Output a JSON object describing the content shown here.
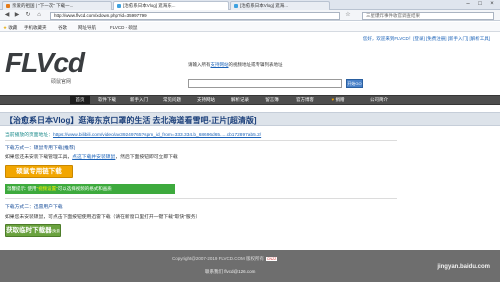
{
  "browser": {
    "tabs": [
      {
        "label": "亲爱的祖国 | \"下一次\" 下载一..."
      },
      {
        "label": "[治愈系日本Vlog] 逛海东..."
      },
      {
        "label": "[治愈系日本Vlog] 逛海..."
      }
    ],
    "url": "http://www.flvcd.com/xdown.php?id=35997799",
    "search_placeholder": "三星爆炸事件收官调查结果",
    "favorites": [
      "收藏",
      "手机收藏夹",
      "谷歌",
      "网址导航",
      "FLVCD - 硕鼠"
    ]
  },
  "site": {
    "top_right": "您好，欢迎来到FLVCD！[登录] [免费注册]  [新手入门] [解析工具]",
    "logo": "FLVcd",
    "logo_sub": "硕鼠官网",
    "hint": "请输入所有",
    "hint_link": "支持网站",
    "hint_tail": "的视频地址或专辑列表地址",
    "analyze_label": "开始GO",
    "nav": [
      "首页",
      "软件下载",
      "新手入门",
      "常见问题",
      "支持网站",
      "解析记录",
      "留言簿",
      "官方博客",
      "捐赠",
      "公司简介"
    ]
  },
  "page": {
    "video_title": "【治愈系日本Vlog】逛海东京口罩的生活 去北海道看雪吧-正片[超清版]",
    "address_label": "当前播放的页面地址：",
    "address_url": "https://www.bilibili.com/video/av39249765?spm_id_from=333.334.b_68696d65.....cb172897ab5.2/",
    "method1_title": "下载方式一：硕鼠专用下载(推荐)",
    "method1_desc": "如果您还未安装下载管理工具，",
    "method1_link": "点这下载并安装硕鼠",
    "method1_tail": "，然后下面按钮即可立即下载",
    "btn1_label": "硕鼠专用链下载",
    "tip_text": "温馨提示: 使用",
    "tip_highlight": "\"视频设置\"",
    "tip_tail": "可以选择视频的格式和画质",
    "method2_title": "下载方式二：迅雷用户下载",
    "method2_desc": "如果您未安装硕鼠，可点击下面按钮使用迅雷下载（请在新窗口里打开一键下载\"取快\"服务）",
    "btn2_label": "获取临时下载器",
    "btn2_sub": "(免费下载)",
    "footer_copy": "Copyright@2007-2019 FLVCD.COM 版权所有",
    "footer_cnzz": "CNZZ",
    "footer_line2": "联系我们 flvcd@126.com",
    "watermark": "jingyan.baidu.com"
  }
}
